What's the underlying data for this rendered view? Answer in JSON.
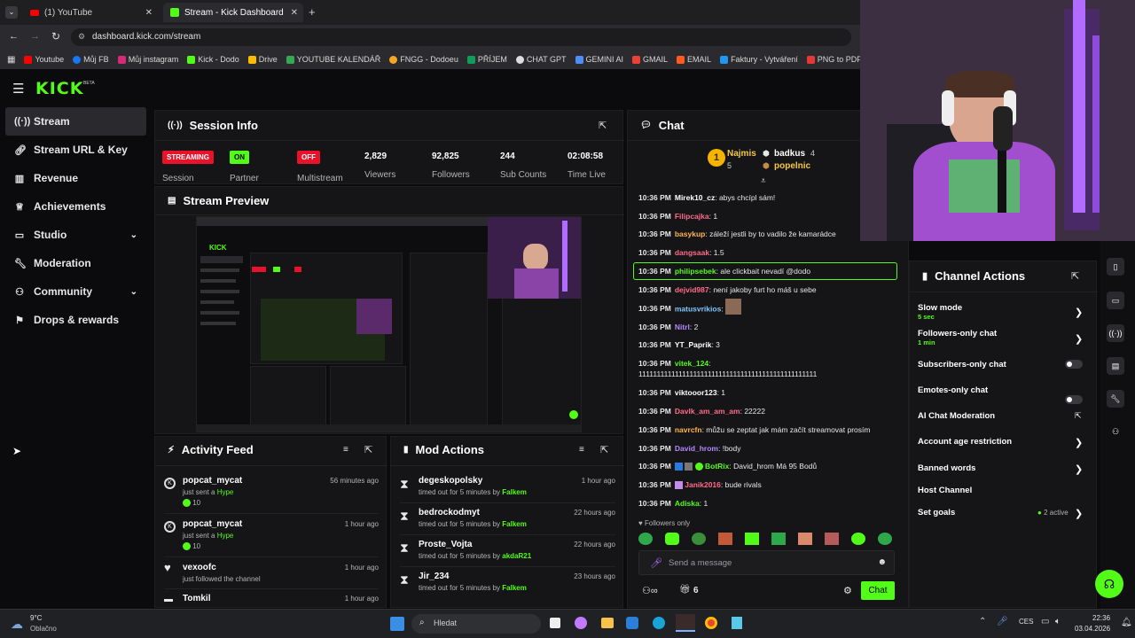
{
  "browser": {
    "tabs": [
      {
        "label": "(1) YouTube"
      },
      {
        "label": "Stream - Kick Dashboard"
      }
    ],
    "url": "dashboard.kick.com/stream",
    "bookmarks": [
      "Youtube",
      "Můj FB",
      "Můj instagram",
      "Kick - Dodo",
      "Drive",
      "YOUTUBE KALENDÁŘ",
      "FNGG - Dodoeu",
      "PŘÍJEM",
      "CHAT GPT",
      "GEMINI AI",
      "GMAIL",
      "EMAIL",
      "Faktury - Vytváření",
      "PNG to PDF"
    ]
  },
  "header": {
    "logo": "KICK",
    "beta": "BETA"
  },
  "sidebar": {
    "items": [
      {
        "label": "Stream"
      },
      {
        "label": "Stream URL & Key"
      },
      {
        "label": "Revenue"
      },
      {
        "label": "Achievements"
      },
      {
        "label": "Studio"
      },
      {
        "label": "Moderation"
      },
      {
        "label": "Community"
      },
      {
        "label": "Drops & rewards"
      }
    ]
  },
  "session": {
    "title": "Session Info",
    "status_badge": "STREAMING",
    "status_label": "Session",
    "partner_badge": "ON",
    "partner_label": "Partner",
    "multistream_badge": "OFF",
    "multistream_label": "Multistream",
    "viewers": "2,829",
    "viewers_label": "Viewers",
    "followers": "92,825",
    "followers_label": "Followers",
    "subs": "244",
    "subs_label": "Sub Counts",
    "time_live": "02:08:58",
    "time_live_label": "Time Live"
  },
  "preview": {
    "title": "Stream Preview"
  },
  "activity": {
    "title": "Activity Feed",
    "items": [
      {
        "name": "popcat_mycat",
        "sub_prefix": "just sent a ",
        "sub_highlight": "Hype",
        "amount": "10",
        "time": "56 minutes ago"
      },
      {
        "name": "popcat_mycat",
        "sub_prefix": "just sent a ",
        "sub_highlight": "Hype",
        "amount": "10",
        "time": "1 hour ago"
      },
      {
        "name": "vexoofc",
        "sub_prefix": "just followed the channel",
        "time": "1 hour ago"
      },
      {
        "name": "Tomkil",
        "time": "1 hour ago"
      }
    ]
  },
  "mod": {
    "title": "Mod Actions",
    "items": [
      {
        "name": "degeskopolsky",
        "action": "timed out for 5 minutes by ",
        "by": "Falkem",
        "time": "1 hour ago"
      },
      {
        "name": "bedrockodmyt",
        "action": "timed out for 5 minutes by ",
        "by": "Falkem",
        "time": "22 hours ago"
      },
      {
        "name": "Proste_Vojta",
        "action": "timed out for 5 minutes by ",
        "by": "akdaR21",
        "time": "22 hours ago"
      },
      {
        "name": "Jir_234",
        "action": "timed out for 5 minutes by ",
        "by": "Falkem",
        "time": "23 hours ago"
      }
    ]
  },
  "chat": {
    "title": "Chat",
    "leaderboard": {
      "rank": "1",
      "first": {
        "name": "Najmis",
        "count": "5"
      },
      "second": {
        "name": "badkus",
        "count": "4"
      },
      "third": {
        "name": "popelnic",
        "count": "1"
      }
    },
    "messages": [
      {
        "time": "10:36 PM",
        "user": "Mirek10_cz",
        "color": "#ffffff",
        "text": ": abys chcípl sám!"
      },
      {
        "time": "10:36 PM",
        "user": "Filipcajka",
        "color": "#ff6b8a",
        "text": ": 1"
      },
      {
        "time": "10:36 PM",
        "user": "basykup",
        "color": "#ffb74d",
        "text": ": záleží jestli by to vadilo že kamarádce"
      },
      {
        "time": "10:36 PM",
        "user": "dangsaak",
        "color": "#ff6b8a",
        "text": ": 1.5"
      },
      {
        "time": "10:36 PM",
        "user": "philipsebek",
        "color": "#53fc18",
        "text": ": ale clickbait nevadí @dodo"
      },
      {
        "time": "10:36 PM",
        "user": "dejvid987",
        "color": "#ff6b8a",
        "text": ": není jakoby furt ho máš u sebe"
      },
      {
        "time": "10:36 PM",
        "user": "matusvrikios",
        "color": "#7ec8ff",
        "text": ":"
      },
      {
        "time": "10:36 PM",
        "user": "Nitrl",
        "color": "#b388ff",
        "text": ": 2"
      },
      {
        "time": "10:36 PM",
        "user": "YT_Paprik",
        "color": "#ffffff",
        "text": ": 3"
      },
      {
        "time": "10:36 PM",
        "user": "vitek_124",
        "color": "#53fc18",
        "text": ":"
      },
      {
        "time": "",
        "user": "",
        "color": "#ffffff",
        "text": "1111111111111111111111111111111111111111111111111"
      },
      {
        "time": "10:36 PM",
        "user": "viktooor123",
        "color": "#ffffff",
        "text": ": 1"
      },
      {
        "time": "10:36 PM",
        "user": "Davlk_am_am_am",
        "color": "#ff6b8a",
        "text": ": 22222"
      },
      {
        "time": "10:36 PM",
        "user": "navrcfn",
        "color": "#ffb74d",
        "text": ": můžu se zeptat jak mám začít streamovat prosím"
      },
      {
        "time": "10:36 PM",
        "user": "David_hrom",
        "color": "#b388ff",
        "text": ": !body"
      },
      {
        "time": "10:36 PM",
        "user": "BotRix",
        "color": "#53fc18",
        "text": ": David_hrom Má 95 Bodů"
      },
      {
        "time": "10:36 PM",
        "user": "Janik2016",
        "color": "#ff6b8a",
        "text": ": bude rivals"
      },
      {
        "time": "10:36 PM",
        "user": "Adiska",
        "color": "#53fc18",
        "text": ": 1"
      }
    ],
    "followers_only": "Followers only",
    "input_placeholder": "Send a message",
    "gift_count": "6",
    "send_label": "Chat"
  },
  "channel_actions": {
    "title": "Channel Actions",
    "items": [
      {
        "label": "Slow mode",
        "sub": "5 sec"
      },
      {
        "label": "Followers-only chat",
        "sub": "1 min"
      },
      {
        "label": "Subscribers-only chat"
      },
      {
        "label": "Emotes-only chat"
      },
      {
        "label": "AI Chat Moderation"
      },
      {
        "label": "Account age restriction"
      },
      {
        "label": "Banned words"
      },
      {
        "label": "Host Channel"
      },
      {
        "label": "Set goals",
        "extra": "2 active"
      }
    ]
  },
  "taskbar": {
    "weather_temp": "9°C",
    "weather_desc": "Oblačno",
    "search_placeholder": "Hledat",
    "lang": "CES",
    "time": "22:36",
    "date": "03.04.2026"
  },
  "colors": {
    "accent": "#53fc18",
    "panel": "#151517",
    "bg": "#0b0b0d"
  }
}
